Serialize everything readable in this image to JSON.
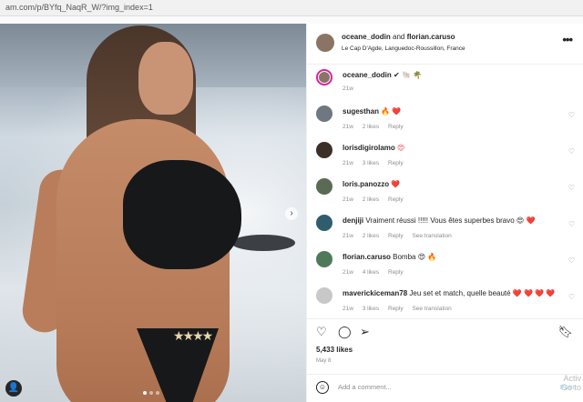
{
  "browser": {
    "url": "am.com/p/BYfq_NaqR_W/?img_index=1"
  },
  "header": {
    "user1": "oceane_dodin",
    "joiner": "and",
    "user2": "florian.caruso",
    "location": "Le Cap D'Agde, Languedoc-Roussillon, France"
  },
  "caption": {
    "username": "oceane_dodin",
    "text": "✔ 🐚 🌴",
    "time": "21w"
  },
  "comments": [
    {
      "username": "sugesthan",
      "text": "🔥 ❤️",
      "time": "21w",
      "likes": "2 likes",
      "reply": "Reply",
      "extra": ""
    },
    {
      "username": "lorisdigirolamo",
      "text": "😍",
      "time": "21w",
      "likes": "3 likes",
      "reply": "Reply",
      "extra": ""
    },
    {
      "username": "loris.panozzo",
      "text": "❤️",
      "time": "21w",
      "likes": "2 likes",
      "reply": "Reply",
      "extra": ""
    },
    {
      "username": "denjiji",
      "text": "Vraiment réussi !!!!! Vous êtes superbes bravo 😍 ❤️",
      "time": "21w",
      "likes": "2 likes",
      "reply": "Reply",
      "extra": "See translation"
    },
    {
      "username": "florian.caruso",
      "text": "Bomba 😍 🔥",
      "time": "21w",
      "likes": "4 likes",
      "reply": "Reply",
      "extra": ""
    },
    {
      "username": "maverickiceman78",
      "text": "Jeu set et match, quelle beauté ❤️ ❤️ ❤️ ❤️",
      "time": "21w",
      "likes": "3 likes",
      "reply": "Reply",
      "extra": "See translation"
    }
  ],
  "post": {
    "likes": "5,433 likes",
    "date": "May 8",
    "comment_placeholder": "Add a comment...",
    "post_label": "Post"
  },
  "watermark": {
    "line1": "Activ",
    "line2": "Go to"
  },
  "icons": [
    "heart-icon",
    "comment-icon",
    "share-icon",
    "bookmark-icon",
    "more-icon",
    "emoji-icon",
    "tag-user-icon",
    "next-arrow-icon"
  ]
}
